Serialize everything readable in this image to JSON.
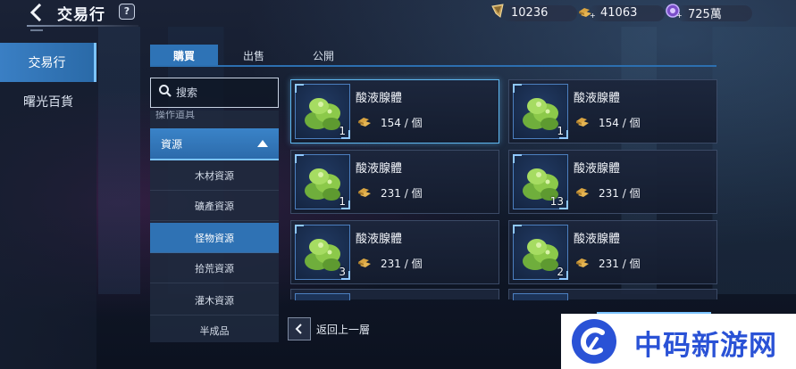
{
  "header": {
    "title": "交易行",
    "help_label": "?",
    "currencies": [
      {
        "icon": "crystal-currency-icon",
        "value": "10236"
      },
      {
        "icon": "gold-bars-plus-icon",
        "value": "41063"
      },
      {
        "icon": "premium-coin-plus-icon",
        "value": "725萬"
      }
    ]
  },
  "sidebar": {
    "items": [
      {
        "label": "交易行",
        "active": true
      },
      {
        "label": "曙光百貨",
        "active": false
      }
    ]
  },
  "tabs": [
    {
      "label": "購買",
      "active": true
    },
    {
      "label": "出售",
      "active": false
    },
    {
      "label": "公開",
      "active": false
    }
  ],
  "search": {
    "placeholder": "搜索"
  },
  "categories": {
    "cut_off_label": "操作道具",
    "header_label": "資源",
    "sub_items": [
      {
        "label": "木材資源",
        "active": false
      },
      {
        "label": "礦產資源",
        "active": false
      },
      {
        "label": "怪物資源",
        "active": true
      },
      {
        "label": "拾荒資源",
        "active": false
      },
      {
        "label": "灌木資源",
        "active": false
      },
      {
        "label": "半成品",
        "active": false
      }
    ]
  },
  "items": [
    {
      "name": "酸液腺體",
      "price": "154 / 個",
      "qty": "1",
      "selected": true
    },
    {
      "name": "酸液腺體",
      "price": "154 / 個",
      "qty": "1",
      "selected": false
    },
    {
      "name": "酸液腺體",
      "price": "231 / 個",
      "qty": "1",
      "selected": false
    },
    {
      "name": "酸液腺體",
      "price": "231 / 個",
      "qty": "13",
      "selected": false
    },
    {
      "name": "酸液腺體",
      "price": "231 / 個",
      "qty": "3",
      "selected": false
    },
    {
      "name": "酸液腺體",
      "price": "231 / 個",
      "qty": "2",
      "selected": false
    }
  ],
  "footer": {
    "back_label": "返回上一層"
  },
  "watermark": {
    "text": "中码新游网"
  },
  "colors": {
    "accent": "#2e73b6",
    "selected_border": "#5fb8f0",
    "watermark_blue": "#2a52d6"
  }
}
